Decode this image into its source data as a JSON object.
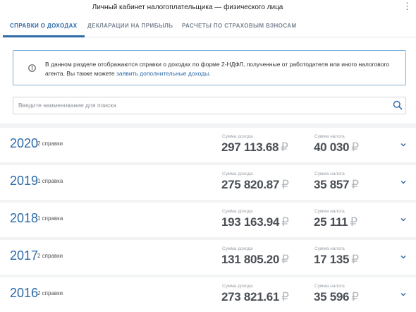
{
  "window": {
    "title": "Личный кабинет налогоплательщика — физического лица",
    "menu_icon": "kebab-menu-icon"
  },
  "tabs": [
    {
      "label": "СПРАВКИ О ДОХОДАХ",
      "active": true
    },
    {
      "label": "ДЕКЛАРАЦИИ НА ПРИБЫЛЬ",
      "active": false
    },
    {
      "label": "РАСЧЕТЫ ПО СТРАХОВЫМ ВЗНОСАМ",
      "active": false
    }
  ],
  "info": {
    "text": "В данном разделе отображаются справки о доходах по форме 2-НДФЛ, полученные от работодателя или иного налогового агента. Вы также можете ",
    "link": "заявить дополнительные доходы",
    "end": "."
  },
  "search": {
    "placeholder": "Введите наименование для поиска",
    "value": ""
  },
  "labels": {
    "income": "Сумма дохода",
    "tax": "Сумма налога",
    "currency": "₽"
  },
  "years": [
    {
      "year": "2020",
      "count": "2 справки",
      "income": "297 113.68",
      "tax": "40 030"
    },
    {
      "year": "2019",
      "count": "1 справка",
      "income": "275 820.87",
      "tax": "35 857"
    },
    {
      "year": "2018",
      "count": "1 справка",
      "income": "193 163.94",
      "tax": "25 111"
    },
    {
      "year": "2017",
      "count": "2 справки",
      "income": "131 805.20",
      "tax": "17 135"
    },
    {
      "year": "2016",
      "count": "2 справки",
      "income": "273 821.61",
      "tax": "35 596"
    }
  ],
  "colors": {
    "accent": "#2c6aa8",
    "border_info": "#7eb0d9",
    "background": "#f2f3f5"
  }
}
